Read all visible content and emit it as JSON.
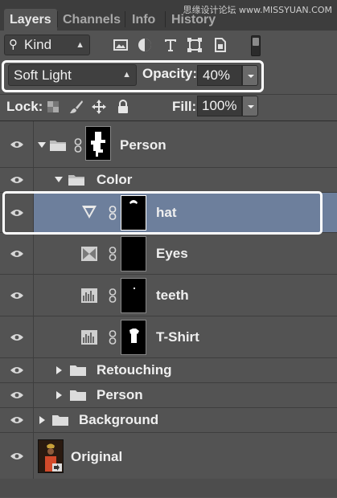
{
  "watermark": "思缘设计论坛 www.MISSYUAN.COM",
  "tabs": [
    "Layers",
    "Channels",
    "Info",
    "History"
  ],
  "filter": {
    "kind_label": "Kind",
    "icons": [
      "image-filter-icon",
      "adjustment-filter-icon",
      "type-filter-icon",
      "shape-filter-icon",
      "smart-object-filter-icon"
    ]
  },
  "blend": {
    "mode": "Soft Light",
    "opacity_label": "Opacity:",
    "opacity_value": "40%"
  },
  "lock": {
    "label": "Lock:",
    "fill_label": "Fill:",
    "fill_value": "100%"
  },
  "layers": [
    {
      "name": "Person",
      "type": "group-with-mask",
      "expanded": true,
      "indent": 0
    },
    {
      "name": "Color",
      "type": "group",
      "expanded": true,
      "indent": 1
    },
    {
      "name": "hat",
      "type": "adjustment-gradient-map",
      "selected": true,
      "indent": 2
    },
    {
      "name": "Eyes",
      "type": "adjustment-channel-mixer",
      "indent": 2
    },
    {
      "name": "teeth",
      "type": "adjustment-levels",
      "indent": 2
    },
    {
      "name": "T-Shirt",
      "type": "adjustment-levels",
      "indent": 2
    },
    {
      "name": "Retouching",
      "type": "group",
      "expanded": false,
      "indent": 1
    },
    {
      "name": "Person",
      "type": "group",
      "expanded": false,
      "indent": 1
    },
    {
      "name": "Background",
      "type": "group",
      "expanded": false,
      "indent": 0
    },
    {
      "name": "Original",
      "type": "smart-object",
      "indent": 0
    }
  ],
  "colors": {
    "selected_row": "#6d7f9c",
    "panel": "#535353",
    "highlight_box": "#ffffff"
  }
}
